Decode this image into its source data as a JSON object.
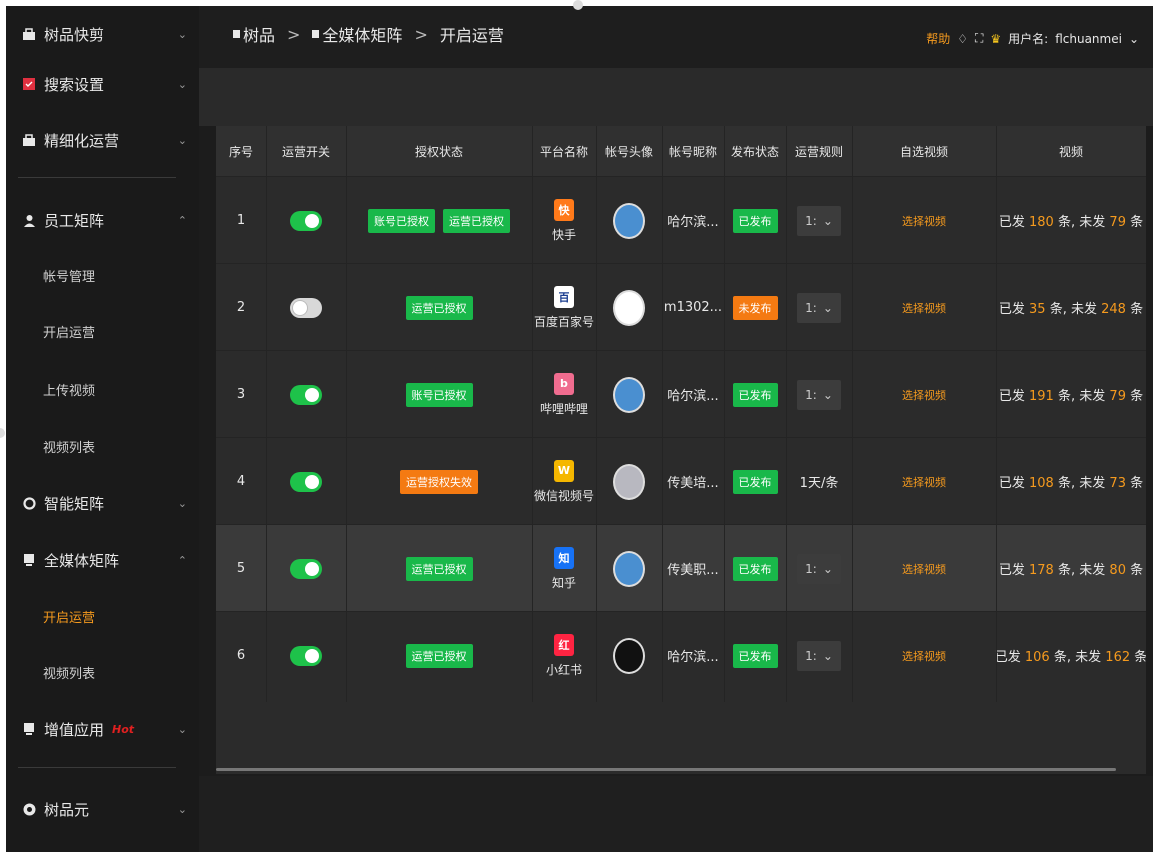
{
  "sidebar": {
    "items": [
      {
        "label": "树品快剪",
        "icon": "briefcase-icon",
        "expanded": false
      },
      {
        "label": "搜索设置",
        "icon": "search-settings-icon",
        "expanded": false
      },
      {
        "label": "精细化运营",
        "icon": "briefcase-icon",
        "expanded": false
      },
      {
        "label": "员工矩阵",
        "icon": "person-icon",
        "expanded": true,
        "children": [
          "帐号管理",
          "开启运营",
          "上传视频",
          "视频列表"
        ]
      },
      {
        "label": "智能矩阵",
        "icon": "gear-icon",
        "expanded": false
      },
      {
        "label": "全媒体矩阵",
        "icon": "media-icon",
        "expanded": true,
        "children": [
          "开启运营",
          "视频列表"
        ],
        "active_child": "开启运营"
      },
      {
        "label": "增值应用",
        "icon": "app-icon",
        "expanded": false,
        "tag": "Hot"
      },
      {
        "label": "树品元",
        "icon": "circle-icon",
        "expanded": false
      }
    ]
  },
  "header": {
    "breadcrumb": [
      "树品",
      "全媒体矩阵",
      "开启运营"
    ],
    "help": "帮助",
    "user_label": "用户名:",
    "username": "flchuanmei"
  },
  "table": {
    "columns": [
      "序号",
      "运营开关",
      "授权状态",
      "平台名称",
      "帐号头像",
      "帐号昵称",
      "发布状态",
      "运营规则",
      "自选视频",
      "视频"
    ],
    "rows": [
      {
        "idx": "1",
        "switch_on": true,
        "auth": [
          {
            "text": "账号已授权",
            "color": "green"
          },
          {
            "text": "运营已授权",
            "color": "green"
          }
        ],
        "platform": "快手",
        "platform_icon": "kuaishou-icon",
        "nickname": "哈尔滨...",
        "status": "已发布",
        "status_color": "green",
        "rule": "1:",
        "pick": "选择视频",
        "sent": "180",
        "unsent": "79",
        "highlight": false
      },
      {
        "idx": "2",
        "switch_on": false,
        "auth": [
          {
            "text": "运营已授权",
            "color": "green"
          }
        ],
        "platform": "百度百家号",
        "platform_icon": "baijiahao-icon",
        "nickname": "m1302...",
        "status": "未发布",
        "status_color": "orange",
        "rule": "1:",
        "pick": "选择视频",
        "sent": "35",
        "unsent": "248",
        "highlight": false
      },
      {
        "idx": "3",
        "switch_on": true,
        "auth": [
          {
            "text": "账号已授权",
            "color": "green"
          }
        ],
        "platform": "哔哩哔哩",
        "platform_icon": "bilibili-icon",
        "nickname": "哈尔滨...",
        "status": "已发布",
        "status_color": "green",
        "rule": "1:",
        "pick": "选择视频",
        "sent": "191",
        "unsent": "79",
        "highlight": false
      },
      {
        "idx": "4",
        "switch_on": true,
        "auth": [
          {
            "text": "运营授权失效",
            "color": "orange"
          }
        ],
        "platform": "微信视频号",
        "platform_icon": "wechat-channels-icon",
        "nickname": "传美培...",
        "status": "已发布",
        "status_color": "green",
        "rule": "1天/条",
        "rule_plain": true,
        "pick": "选择视频",
        "sent": "108",
        "unsent": "73",
        "highlight": false
      },
      {
        "idx": "5",
        "switch_on": true,
        "auth": [
          {
            "text": "运营已授权",
            "color": "green"
          }
        ],
        "platform": "知乎",
        "platform_icon": "zhihu-icon",
        "nickname": "传美职...",
        "status": "已发布",
        "status_color": "green",
        "rule": "1:",
        "pick": "选择视频",
        "sent": "178",
        "unsent": "80",
        "highlight": true
      },
      {
        "idx": "6",
        "switch_on": true,
        "auth": [
          {
            "text": "运营已授权",
            "color": "green"
          }
        ],
        "platform": "小红书",
        "platform_icon": "xiaohongshu-icon",
        "nickname": "哈尔滨...",
        "status": "已发布",
        "status_color": "green",
        "rule": "1:",
        "pick": "选择视频",
        "sent": "106",
        "unsent": "162",
        "highlight": false
      }
    ],
    "video_text": {
      "sent_prefix": "已发",
      "unit": "条",
      "unsent_prefix": "未发"
    }
  },
  "colors": {
    "accent": "#f59a1e",
    "green": "#19b84a",
    "orange": "#f47a12",
    "bg": "#1c1c1c"
  }
}
